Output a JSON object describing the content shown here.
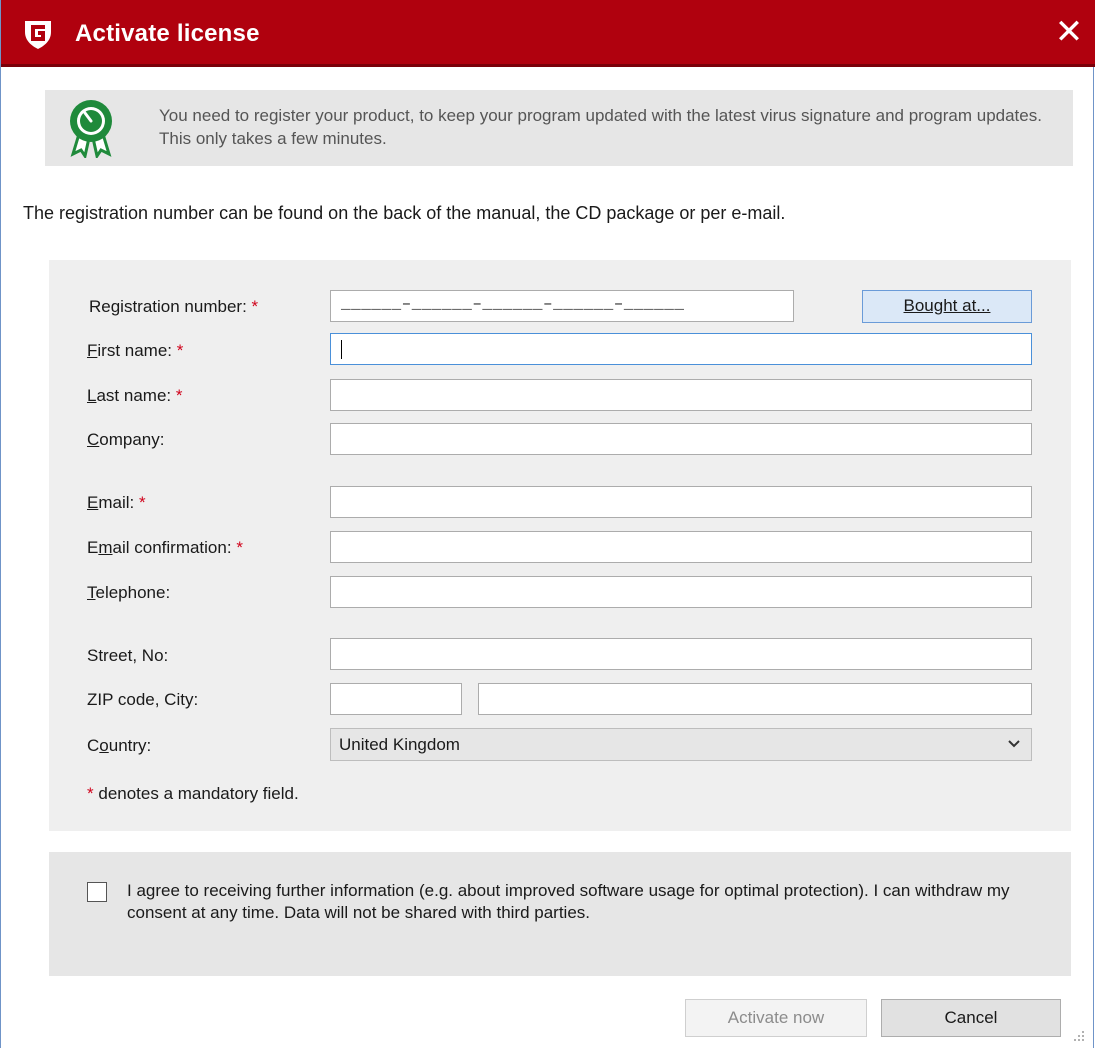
{
  "window": {
    "title": "Activate license",
    "close_glyph": "✕",
    "accent_color": "#b0010e"
  },
  "banner": {
    "text": "You need to register your product, to keep your program updated with the latest virus signature and program updates. This only takes a few minutes."
  },
  "intro": "The registration number can be found on the back of the manual, the CD package or per e-mail.",
  "form": {
    "registration_label": "Registration number:",
    "registration_mask": "______–______–______–______–______",
    "bought_button": "Bought at...",
    "required_marker": "*",
    "first_name": {
      "mnemonic": "F",
      "rest": "irst name:",
      "value": ""
    },
    "last_name": {
      "mnemonic": "L",
      "rest": "ast name:",
      "value": ""
    },
    "company": {
      "mnemonic": "C",
      "rest": "ompany:",
      "value": ""
    },
    "email": {
      "mnemonic": "E",
      "rest": "mail:",
      "value": ""
    },
    "email_confirmation": {
      "pre": "E",
      "mnemonic": "m",
      "rest": "ail confirmation:",
      "value": ""
    },
    "telephone": {
      "mnemonic": "T",
      "rest": "elephone:",
      "value": ""
    },
    "street_label": "Street, No:",
    "zip_label": "ZIP code, City:",
    "country": {
      "pre": "C",
      "mnemonic": "o",
      "rest": "untry:",
      "selected": "United Kingdom"
    },
    "mandatory_note": "denotes a mandatory field."
  },
  "consent": {
    "checked": false,
    "text": "I agree to receiving further information (e.g. about improved software usage for optimal protection). I can withdraw my consent at any time. Data will not be shared with third parties."
  },
  "footer": {
    "activate_label": "Activate now",
    "cancel_label": "Cancel"
  },
  "icons": {
    "logo": "gdata-shield-icon",
    "banner": "award-clock-icon",
    "dropdown": "chevron-down-icon"
  }
}
